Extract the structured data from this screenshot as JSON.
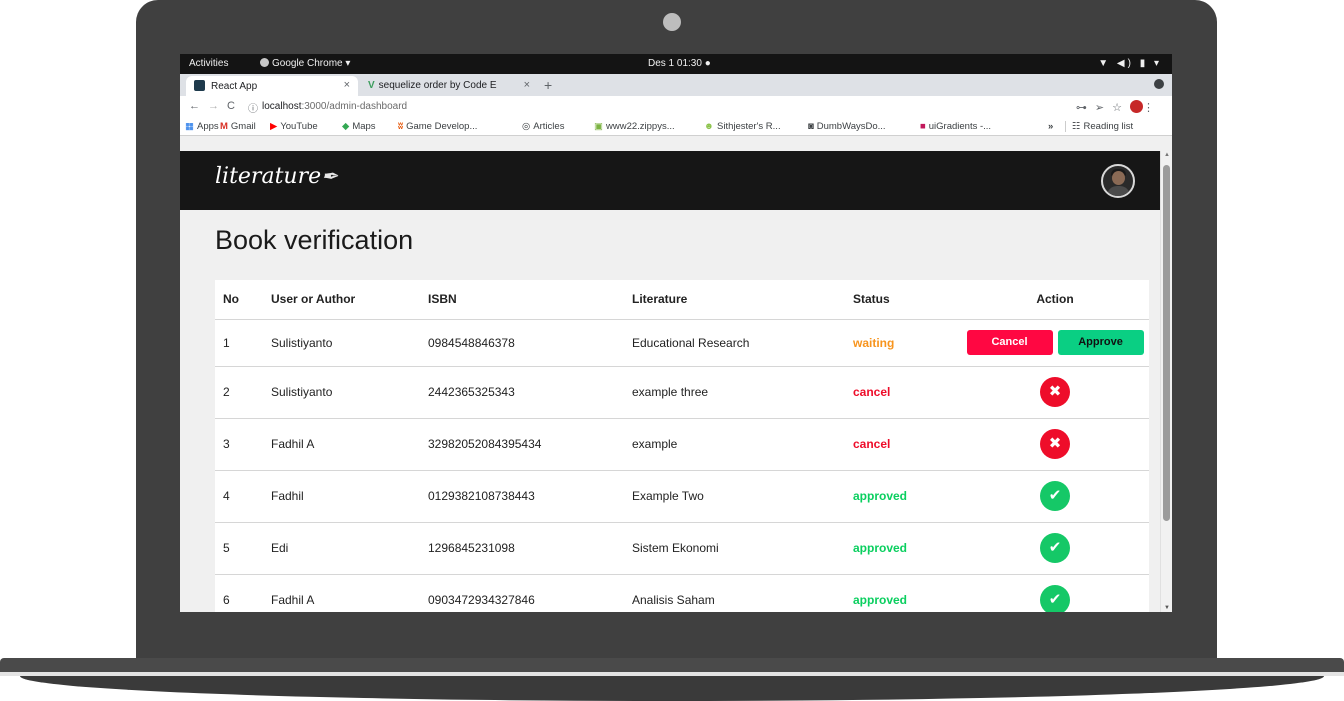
{
  "os_bar": {
    "activities": "Activities",
    "app": "Google Chrome ▾",
    "clock": "Des 1  01:30  ●",
    "tray": "▼ ◀) ▮ ▾"
  },
  "browser": {
    "tabs": [
      {
        "label": "React App",
        "active": true
      },
      {
        "label": "sequelize order by Code E",
        "active": false
      }
    ],
    "url_host": "localhost",
    "url_rest": ":3000/admin-dashboard",
    "bookmarks": [
      {
        "icon": "▦",
        "label": "Apps"
      },
      {
        "icon": "M",
        "label": "Gmail"
      },
      {
        "icon": "▶",
        "label": "YouTube"
      },
      {
        "icon": "◆",
        "label": "Maps"
      },
      {
        "icon": "ʬ",
        "label": "Game Develop..."
      },
      {
        "icon": "◎",
        "label": "Articles"
      },
      {
        "icon": "▣",
        "label": "www22.zippys..."
      },
      {
        "icon": "☻",
        "label": "Sithjester's R..."
      },
      {
        "icon": "◙",
        "label": "DumbWaysDo..."
      },
      {
        "icon": "■",
        "label": "uiGradients -..."
      },
      {
        "icon": "»",
        "label": ""
      },
      {
        "icon": "☷",
        "label": "Reading list"
      }
    ]
  },
  "app": {
    "brand": "literature",
    "page_title": "Book verification",
    "columns": [
      "No",
      "User or Author",
      "ISBN",
      "Literature",
      "Status",
      "Action"
    ],
    "buttons": {
      "cancel": "Cancel",
      "approve": "Approve"
    },
    "rows": [
      {
        "no": "1",
        "user": "Sulistiyanto",
        "isbn": "0984548846378",
        "literature": "Educational Research",
        "status": "waiting"
      },
      {
        "no": "2",
        "user": "Sulistiyanto",
        "isbn": "2442365325343",
        "literature": "example three",
        "status": "cancel"
      },
      {
        "no": "3",
        "user": "Fadhil A",
        "isbn": "32982052084395434",
        "literature": "example",
        "status": "cancel"
      },
      {
        "no": "4",
        "user": "Fadhil",
        "isbn": "0129382108738443",
        "literature": "Example Two",
        "status": "approved"
      },
      {
        "no": "5",
        "user": "Edi",
        "isbn": "1296845231098",
        "literature": "Sistem Ekonomi",
        "status": "approved"
      },
      {
        "no": "6",
        "user": "Fadhil A",
        "isbn": "0903472934327846",
        "literature": "Analisis Saham",
        "status": "approved"
      }
    ]
  },
  "colors": {
    "waiting": "#f7941d",
    "cancel": "#ee0d2a",
    "approved": "#0acf5f",
    "nav_bg": "#161616"
  }
}
